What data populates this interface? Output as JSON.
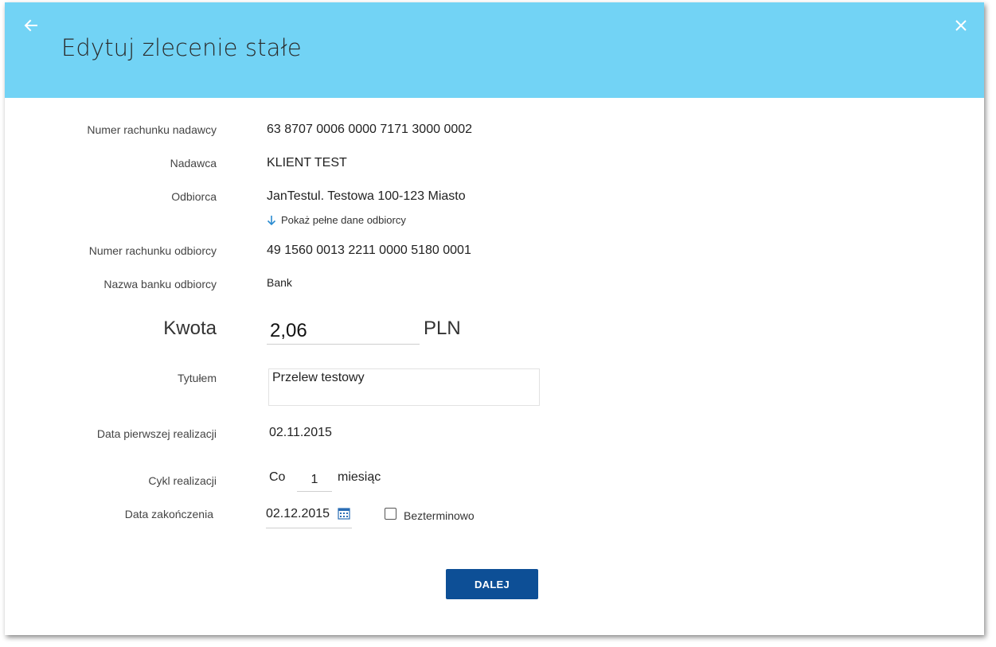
{
  "header": {
    "title": "Edytuj zlecenie stałe",
    "back_icon": "arrow-left-icon",
    "close_icon": "close-icon",
    "background_color": "#72d3f5"
  },
  "form": {
    "sender_account": {
      "label": "Numer rachunku nadawcy",
      "value": "63 8707 0006 0000 7171 3000 0002"
    },
    "sender": {
      "label": "Nadawca",
      "value": "KLIENT TEST"
    },
    "recipient": {
      "label": "Odbiorca",
      "value": "JanTestul. Testowa 100-123 Miasto"
    },
    "show_full_recipient": {
      "label": "Pokaż pełne dane odbiorcy",
      "icon": "arrow-down-icon"
    },
    "recipient_account": {
      "label": "Numer rachunku odbiorcy",
      "value": "49 1560 0013 2211 0000 5180 0001"
    },
    "recipient_bank": {
      "label": "Nazwa banku odbiorcy",
      "value": "Bank"
    },
    "amount": {
      "label": "Kwota",
      "value": "2,06",
      "currency": "PLN"
    },
    "transfer_title": {
      "label": "Tytułem",
      "value": "Przelew testowy"
    },
    "first_date": {
      "label": "Data pierwszej realizacji",
      "value": "02.11.2015"
    },
    "cycle": {
      "label": "Cykl realizacji",
      "prefix": "Co",
      "value": "1",
      "unit": "miesiąc"
    },
    "end_date": {
      "label": "Data zakończenia",
      "value": "02.12.2015",
      "icon": "calendar-icon"
    },
    "indefinite": {
      "label": "Bezterminowo",
      "checked": false
    }
  },
  "actions": {
    "next_label": "DALEJ",
    "next_color": "#0d4f96"
  }
}
